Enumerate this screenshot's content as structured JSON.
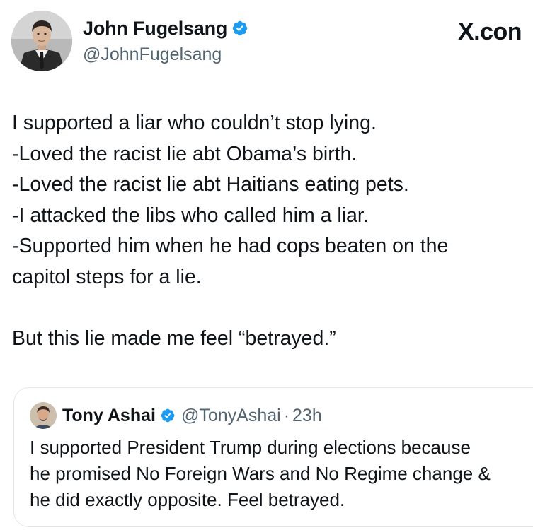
{
  "author": {
    "display_name": "John Fugelsang",
    "handle": "@JohnFugelsang",
    "verified_icon": "verified-badge-icon"
  },
  "brand": {
    "label": "X.con"
  },
  "tweet": {
    "lines": [
      "I supported a liar who couldn’t stop lying.",
      "-Loved the racist lie abt Obama’s birth.",
      "-Loved the racist lie abt Haitians eating pets.",
      "-I attacked the libs who called him a liar.",
      "-Supported him when he had cops beaten on the",
      "capitol steps for a lie.",
      "",
      "But this lie made me feel “betrayed.”"
    ]
  },
  "quote": {
    "display_name": "Tony Ashai",
    "handle": "@TonyAshai",
    "separator": "·",
    "time": "23h",
    "lines": [
      "I supported President Trump during elections because",
      "he promised No Foreign Wars and No Regime change &",
      "he did exactly opposite. Feel betrayed."
    ]
  },
  "colors": {
    "text": "#0f1419",
    "secondary": "#536471",
    "verified_blue": "#1d9bf0",
    "border": "#e3e6e9"
  }
}
